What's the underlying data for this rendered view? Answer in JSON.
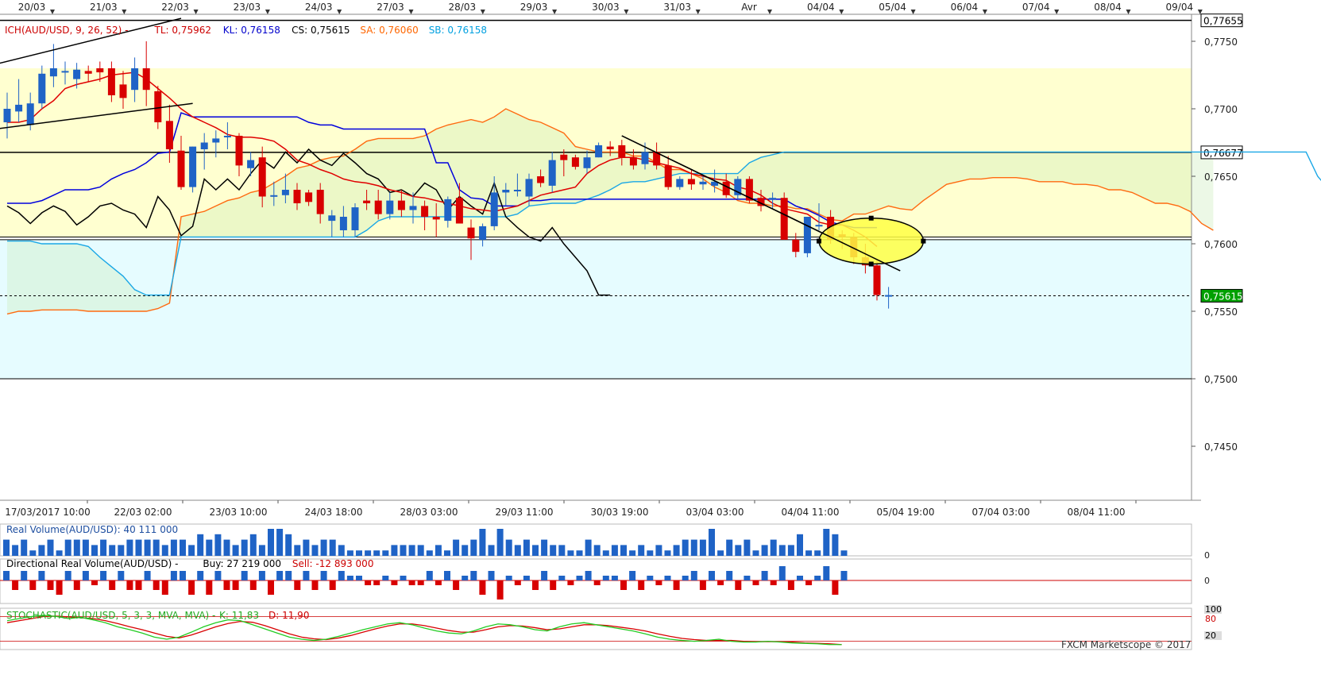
{
  "chart_data": {
    "type": "candlestick",
    "instrument": "AUD/USD",
    "watermark": "FXCM Marketscope © 2017",
    "top_dates": [
      "20/03",
      "21/03",
      "22/03",
      "23/03",
      "24/03",
      "27/03",
      "28/03",
      "29/03",
      "30/03",
      "31/03",
      "Avr",
      "04/04",
      "05/04",
      "06/04",
      "07/04",
      "08/04",
      "09/04"
    ],
    "bottom_times": [
      "17/03/2017 10:00",
      "22/03 02:00",
      "23/03 10:00",
      "24/03 18:00",
      "28/03 03:00",
      "29/03 11:00",
      "30/03 19:00",
      "03/04 03:00",
      "04/04 11:00",
      "05/04 19:00",
      "07/04 03:00",
      "08/04 11:00"
    ],
    "ylim": [
      0.741,
      0.777
    ],
    "y_ticks": [
      0.775,
      0.77,
      0.765,
      0.76,
      0.755,
      0.75,
      0.745
    ],
    "y_tick_labels": [
      "0,7750",
      "0,7700",
      "0,7650",
      "0,7600",
      "0,7550",
      "0,7500",
      "0,7450"
    ],
    "price_tags": [
      {
        "value": 0.77655,
        "label": "0,77655",
        "bg": "#ffffff",
        "fg": "#000000"
      },
      {
        "value": 0.76677,
        "label": "0,76677",
        "bg": "#ffffff",
        "fg": "#000000"
      },
      {
        "value": 0.75615,
        "label": "0,75615",
        "bg": "#00a000",
        "fg": "#ffffff"
      }
    ],
    "ichimoku_legend": [
      {
        "text": "ICH(AUD/USD, 9, 26, 52) -",
        "color": "#cc0000"
      },
      {
        "text": "TL: 0,75962",
        "color": "#cc0000"
      },
      {
        "text": "KL: 0,76158",
        "color": "#0000cc"
      },
      {
        "text": "CS: 0,75615",
        "color": "#000000"
      },
      {
        "text": "SA: 0,76060",
        "color": "#ff6600"
      },
      {
        "text": "SB: 0,76158",
        "color": "#00a0e0"
      }
    ],
    "zones": [
      {
        "from": 0.7605,
        "to": 0.773,
        "color": "#ffffd0"
      },
      {
        "from": 0.75,
        "to": 0.7603,
        "color": "#e6fcff"
      }
    ],
    "horizontal_lines": [
      0.77655,
      0.76677,
      0.7605,
      0.7603,
      0.75
    ],
    "candles": [
      [
        0.769,
        0.7712,
        0.7678,
        0.77
      ],
      [
        0.7698,
        0.7722,
        0.769,
        0.7703
      ],
      [
        0.7688,
        0.7712,
        0.7684,
        0.7704
      ],
      [
        0.7704,
        0.7732,
        0.77,
        0.7726
      ],
      [
        0.7724,
        0.7748,
        0.7716,
        0.773
      ],
      [
        0.7727,
        0.7735,
        0.7718,
        0.7728
      ],
      [
        0.7722,
        0.7734,
        0.7715,
        0.7729
      ],
      [
        0.7728,
        0.7732,
        0.772,
        0.7726
      ],
      [
        0.773,
        0.7735,
        0.772,
        0.7727
      ],
      [
        0.773,
        0.7735,
        0.7705,
        0.771
      ],
      [
        0.7718,
        0.7728,
        0.77,
        0.7708
      ],
      [
        0.7714,
        0.7738,
        0.7705,
        0.773
      ],
      [
        0.773,
        0.775,
        0.7702,
        0.7714
      ],
      [
        0.7713,
        0.7717,
        0.7685,
        0.769
      ],
      [
        0.7691,
        0.7703,
        0.766,
        0.767
      ],
      [
        0.7669,
        0.768,
        0.764,
        0.7642
      ],
      [
        0.7642,
        0.7672,
        0.7638,
        0.7672
      ],
      [
        0.767,
        0.7682,
        0.7655,
        0.7675
      ],
      [
        0.7675,
        0.7684,
        0.7664,
        0.7678
      ],
      [
        0.768,
        0.769,
        0.767,
        0.768
      ],
      [
        0.768,
        0.7682,
        0.765,
        0.7658
      ],
      [
        0.7656,
        0.7668,
        0.765,
        0.7662
      ],
      [
        0.7664,
        0.7672,
        0.7627,
        0.7635
      ],
      [
        0.7636,
        0.7646,
        0.7628,
        0.7636
      ],
      [
        0.7636,
        0.7652,
        0.763,
        0.764
      ],
      [
        0.764,
        0.7645,
        0.7625,
        0.763
      ],
      [
        0.7638,
        0.764,
        0.7628,
        0.7631
      ],
      [
        0.764,
        0.7645,
        0.7615,
        0.7622
      ],
      [
        0.7617,
        0.7625,
        0.7605,
        0.7621
      ],
      [
        0.761,
        0.7628,
        0.7605,
        0.762
      ],
      [
        0.761,
        0.763,
        0.7605,
        0.7627
      ],
      [
        0.7632,
        0.764,
        0.7625,
        0.763
      ],
      [
        0.7632,
        0.764,
        0.7618,
        0.7622
      ],
      [
        0.7622,
        0.7638,
        0.7618,
        0.7632
      ],
      [
        0.7632,
        0.764,
        0.762,
        0.7625
      ],
      [
        0.7625,
        0.7638,
        0.7615,
        0.7628
      ],
      [
        0.7628,
        0.7632,
        0.761,
        0.762
      ],
      [
        0.762,
        0.763,
        0.7605,
        0.7618
      ],
      [
        0.7617,
        0.7635,
        0.7612,
        0.7633
      ],
      [
        0.7634,
        0.7645,
        0.762,
        0.7615
      ],
      [
        0.7612,
        0.7618,
        0.7588,
        0.7604
      ],
      [
        0.7603,
        0.7615,
        0.7598,
        0.7613
      ],
      [
        0.7613,
        0.765,
        0.761,
        0.7638
      ],
      [
        0.7638,
        0.7645,
        0.7628,
        0.764
      ],
      [
        0.764,
        0.7652,
        0.7635,
        0.764
      ],
      [
        0.7635,
        0.7652,
        0.7628,
        0.7648
      ],
      [
        0.765,
        0.7655,
        0.7642,
        0.7645
      ],
      [
        0.7643,
        0.7668,
        0.7638,
        0.7662
      ],
      [
        0.7666,
        0.767,
        0.765,
        0.7662
      ],
      [
        0.7664,
        0.7666,
        0.7655,
        0.7657
      ],
      [
        0.7656,
        0.7669,
        0.7652,
        0.7664
      ],
      [
        0.7664,
        0.7675,
        0.7664,
        0.7673
      ],
      [
        0.7672,
        0.7676,
        0.7665,
        0.767
      ],
      [
        0.7673,
        0.7677,
        0.7658,
        0.7664
      ],
      [
        0.7664,
        0.767,
        0.7655,
        0.7658
      ],
      [
        0.7659,
        0.7675,
        0.7655,
        0.7668
      ],
      [
        0.7668,
        0.7675,
        0.7655,
        0.7658
      ],
      [
        0.7658,
        0.7665,
        0.764,
        0.7642
      ],
      [
        0.7642,
        0.765,
        0.764,
        0.7648
      ],
      [
        0.7648,
        0.7655,
        0.764,
        0.7644
      ],
      [
        0.7644,
        0.765,
        0.764,
        0.7646
      ],
      [
        0.7643,
        0.7655,
        0.7638,
        0.7646
      ],
      [
        0.7646,
        0.7652,
        0.7634,
        0.7636
      ],
      [
        0.7636,
        0.765,
        0.7633,
        0.7648
      ],
      [
        0.7648,
        0.765,
        0.763,
        0.7632
      ],
      [
        0.7634,
        0.764,
        0.7624,
        0.7628
      ],
      [
        0.7633,
        0.7638,
        0.7626,
        0.7634
      ],
      [
        0.7634,
        0.7638,
        0.7603,
        0.7603
      ],
      [
        0.7603,
        0.7608,
        0.759,
        0.7594
      ],
      [
        0.7593,
        0.762,
        0.759,
        0.762
      ],
      [
        0.7614,
        0.763,
        0.761,
        0.7614
      ],
      [
        0.762,
        0.7625,
        0.76,
        0.7603
      ],
      [
        0.7607,
        0.761,
        0.7596,
        0.7605
      ],
      [
        0.7605,
        0.7608,
        0.7585,
        0.759
      ],
      [
        0.759,
        0.76,
        0.7578,
        0.7584
      ],
      [
        0.7584,
        0.7588,
        0.7558,
        0.7562
      ],
      [
        0.7562,
        0.7568,
        0.7552,
        0.7562
      ]
    ],
    "tenkan": [
      0.769,
      0.769,
      0.7692,
      0.77,
      0.7706,
      0.7715,
      0.7718,
      0.772,
      0.7722,
      0.7725,
      0.7726,
      0.7727,
      0.7722,
      0.7715,
      0.7708,
      0.77,
      0.7694,
      0.769,
      0.7686,
      0.7681,
      0.7679,
      0.7679,
      0.7678,
      0.7676,
      0.767,
      0.7662,
      0.7659,
      0.7655,
      0.7652,
      0.7648,
      0.7646,
      0.7645,
      0.7643,
      0.764,
      0.7638,
      0.7635,
      0.7634,
      0.7632,
      0.763,
      0.7628,
      0.7626,
      0.7625,
      0.7624,
      0.7626,
      0.7628,
      0.7632,
      0.7636,
      0.7638,
      0.764,
      0.7642,
      0.7652,
      0.7658,
      0.7662,
      0.7664,
      0.7664,
      0.7662,
      0.766,
      0.7658,
      0.7656,
      0.7652,
      0.765,
      0.7648,
      0.7647,
      0.7642,
      0.764,
      0.7636,
      0.763,
      0.7626,
      0.7624,
      0.7622,
      0.7616,
      0.7614,
      0.7614,
      0.761,
      0.7605,
      0.7598
    ],
    "kijun": [
      0.763,
      0.763,
      0.763,
      0.7632,
      0.7636,
      0.764,
      0.764,
      0.764,
      0.7642,
      0.7648,
      0.7652,
      0.7655,
      0.766,
      0.7667,
      0.7668,
      0.7697,
      0.7694,
      0.7694,
      0.7694,
      0.7694,
      0.7694,
      0.7694,
      0.7694,
      0.7694,
      0.7694,
      0.7694,
      0.769,
      0.7688,
      0.7688,
      0.7685,
      0.7685,
      0.7685,
      0.7685,
      0.7685,
      0.7685,
      0.7685,
      0.7685,
      0.766,
      0.766,
      0.764,
      0.7634,
      0.7633,
      0.7628,
      0.7628,
      0.7628,
      0.7632,
      0.7632,
      0.7633,
      0.7633,
      0.7633,
      0.7633,
      0.7633,
      0.7633,
      0.7633,
      0.7633,
      0.7633,
      0.7633,
      0.7633,
      0.7633,
      0.7633,
      0.7633,
      0.7633,
      0.7633,
      0.7633,
      0.7633,
      0.7633,
      0.7633,
      0.7633,
      0.7628,
      0.7625,
      0.7621,
      0.7616,
      0.7614,
      0.7612,
      0.7612,
      0.7612
    ],
    "chikou": [
      0.7628,
      0.7623,
      0.7615,
      0.7623,
      0.7628,
      0.7624,
      0.7614,
      0.762,
      0.7628,
      0.763,
      0.7625,
      0.7622,
      0.7612,
      0.7635,
      0.7625,
      0.7606,
      0.7613,
      0.7648,
      0.764,
      0.7648,
      0.764,
      0.7652,
      0.7662,
      0.7656,
      0.7668,
      0.766,
      0.767,
      0.7662,
      0.7658,
      0.7667,
      0.766,
      0.7652,
      0.7648,
      0.7638,
      0.764,
      0.7635,
      0.7645,
      0.764,
      0.7625,
      0.7635,
      0.7628,
      0.7622,
      0.7645,
      0.762,
      0.7612,
      0.7605,
      0.7602,
      0.7612,
      0.76,
      0.759,
      0.758,
      0.7562,
      0.7562
    ],
    "senkou_a": [
      0.7548,
      0.755,
      0.755,
      0.7551,
      0.7551,
      0.7551,
      0.7551,
      0.755,
      0.755,
      0.755,
      0.755,
      0.755,
      0.755,
      0.7552,
      0.7556,
      0.762,
      0.7622,
      0.7624,
      0.7628,
      0.7632,
      0.7634,
      0.7638,
      0.764,
      0.7645,
      0.765,
      0.7656,
      0.7658,
      0.7662,
      0.7664,
      0.7665,
      0.767,
      0.7676,
      0.7678,
      0.7678,
      0.7678,
      0.7678,
      0.768,
      0.7685,
      0.7688,
      0.769,
      0.7692,
      0.769,
      0.7694,
      0.77,
      0.7696,
      0.7692,
      0.769,
      0.7686,
      0.7682,
      0.7672,
      0.767,
      0.7668,
      0.7668,
      0.7668,
      0.7665,
      0.7665,
      0.766,
      0.7655,
      0.7655,
      0.7652,
      0.7648,
      0.7642,
      0.7638,
      0.7632,
      0.763,
      0.763,
      0.7628,
      0.7628,
      0.7626,
      0.7626,
      0.7622,
      0.7618,
      0.7617,
      0.7622,
      0.7622,
      0.7625,
      0.7628,
      0.7626,
      0.7625,
      0.7632,
      0.7638,
      0.7644,
      0.7646,
      0.7648,
      0.7648,
      0.7649,
      0.7649,
      0.7649,
      0.7648,
      0.7646,
      0.7646,
      0.7646,
      0.7644,
      0.7644,
      0.7643,
      0.764,
      0.764,
      0.7638,
      0.7634,
      0.763,
      0.763,
      0.7628,
      0.7624,
      0.7615,
      0.761
    ],
    "senkou_b": [
      0.7602,
      0.7602,
      0.7602,
      0.76,
      0.76,
      0.76,
      0.76,
      0.7598,
      0.759,
      0.7583,
      0.7576,
      0.7566,
      0.7562,
      0.7562,
      0.7562,
      0.7605,
      0.7605,
      0.7605,
      0.7605,
      0.7605,
      0.7605,
      0.7605,
      0.7605,
      0.7605,
      0.7605,
      0.7605,
      0.7605,
      0.7605,
      0.7605,
      0.7605,
      0.7605,
      0.761,
      0.7617,
      0.762,
      0.762,
      0.762,
      0.762,
      0.762,
      0.762,
      0.762,
      0.762,
      0.762,
      0.762,
      0.762,
      0.7622,
      0.7628,
      0.7629,
      0.763,
      0.763,
      0.763,
      0.7633,
      0.7636,
      0.764,
      0.7645,
      0.7646,
      0.7646,
      0.7648,
      0.765,
      0.7652,
      0.7652,
      0.7652,
      0.7652,
      0.7652,
      0.7652,
      0.766,
      0.7664,
      0.7666,
      0.7668,
      0.7668,
      0.7668,
      0.7668,
      0.7668,
      0.7668,
      0.7668,
      0.7668,
      0.7668,
      0.7668,
      0.7668,
      0.7668,
      0.7668,
      0.7668,
      0.7668,
      0.7668,
      0.7668,
      0.7668,
      0.7668,
      0.7668,
      0.7668,
      0.7668,
      0.7668,
      0.7668,
      0.7668,
      0.7668,
      0.7668,
      0.7668,
      0.7668,
      0.7668,
      0.7668,
      0.7668,
      0.7668,
      0.7668,
      0.7668,
      0.7668,
      0.7668,
      0.7668,
      0.7668,
      0.7668,
      0.7668,
      0.7668,
      0.7668,
      0.7668,
      0.7668,
      0.7668,
      0.765,
      0.764,
      0.7628,
      0.7626,
      0.7624,
      0.762,
      0.7614
    ],
    "trendlines": [
      {
        "from": [
          -1,
          0.7733
        ],
        "to": [
          15,
          0.7767
        ]
      },
      {
        "from": [
          -1,
          0.7685
        ],
        "to": [
          16,
          0.7704
        ]
      },
      {
        "from": [
          53,
          0.768
        ],
        "to": [
          77,
          0.758
        ]
      }
    ],
    "highlight_ellipse": {
      "center": [
        74.5,
        0.7602
      ],
      "radius_x": 4.5,
      "radius_y": 0.0017
    },
    "volume": {
      "title": "Real Volume(AUD/USD): 40 111 000",
      "y_tick_labels": [
        "0"
      ],
      "values": [
        3,
        2,
        3,
        1,
        2,
        3,
        1,
        3,
        3,
        3,
        2,
        3,
        2,
        2,
        3,
        3,
        3,
        3,
        2,
        3,
        3,
        2,
        4,
        3,
        4,
        3,
        2,
        3,
        4,
        2,
        5,
        5,
        4,
        2,
        3,
        2,
        3,
        3,
        2,
        1,
        1,
        1,
        1,
        1,
        2,
        2,
        2,
        2,
        1,
        2,
        1,
        3,
        2,
        3,
        5,
        2,
        5,
        3,
        2,
        3,
        2,
        3,
        2,
        2,
        1,
        1,
        3,
        2,
        1,
        2,
        2,
        1,
        2,
        1,
        2,
        1,
        2,
        3,
        3,
        3,
        5,
        1,
        3,
        2,
        3,
        1,
        2,
        3,
        2,
        2,
        4,
        1,
        1,
        5,
        4,
        1
      ]
    },
    "directional": {
      "title_parts": [
        {
          "text": "Directional Real Volume(AUD/USD) -",
          "color": "#000000"
        },
        {
          "text": "Buy: 27 219 000",
          "color": "#000000"
        },
        {
          "text": "Sell: -12 893 000",
          "color": "#cc0000"
        }
      ],
      "y_tick_labels": [
        "0"
      ],
      "values": [
        2,
        -2,
        2,
        -2,
        2,
        -2,
        -3,
        2,
        -2,
        2,
        -1,
        2,
        -2,
        2,
        -2,
        -2,
        2,
        -2,
        -3,
        2,
        2,
        -3,
        2,
        -3,
        2,
        -2,
        -2,
        2,
        -2,
        2,
        -3,
        2,
        2,
        -2,
        2,
        -2,
        2,
        -2,
        2,
        1,
        1,
        -1,
        -1,
        1,
        -1,
        1,
        -1,
        -1,
        2,
        -1,
        2,
        -2,
        1,
        2,
        -3,
        2,
        -4,
        1,
        -1,
        1,
        -2,
        2,
        -2,
        1,
        -1,
        1,
        2,
        -1,
        1,
        1,
        -2,
        2,
        -2,
        1,
        -1,
        1,
        -2,
        1,
        2,
        -2,
        2,
        -1,
        2,
        -2,
        1,
        -1,
        2,
        -1,
        3,
        -2,
        1,
        -1,
        1,
        3,
        -3,
        2
      ]
    },
    "stochastic": {
      "title": "STOCHASTIC(AUD/USD, 5, 3, 3, MVA, MVA) -",
      "k_label": "K: 11,83",
      "d_label": "D: 11,90",
      "ylim": [
        0,
        100
      ],
      "levels": [
        80,
        20
      ],
      "level_tags": [
        "100",
        "80",
        "20"
      ],
      "k": [
        70,
        75,
        80,
        83,
        80,
        75,
        78,
        72,
        65,
        55,
        48,
        40,
        30,
        25,
        30,
        42,
        55,
        65,
        72,
        70,
        60,
        50,
        40,
        30,
        25,
        22,
        25,
        32,
        40,
        48,
        55,
        62,
        65,
        60,
        52,
        45,
        40,
        38,
        45,
        55,
        62,
        60,
        55,
        48,
        45,
        55,
        62,
        65,
        60,
        55,
        50,
        45,
        38,
        30,
        25,
        22,
        20,
        22,
        25,
        20,
        18,
        18,
        20,
        18,
        16,
        15,
        14,
        12,
        12
      ],
      "d": [
        65,
        70,
        75,
        80,
        81,
        79,
        77,
        75,
        70,
        63,
        55,
        48,
        40,
        32,
        28,
        35,
        45,
        55,
        63,
        68,
        66,
        58,
        48,
        38,
        30,
        26,
        24,
        28,
        34,
        42,
        50,
        57,
        62,
        62,
        58,
        52,
        46,
        42,
        42,
        48,
        55,
        58,
        57,
        53,
        48,
        50,
        55,
        60,
        60,
        58,
        54,
        50,
        45,
        38,
        32,
        27,
        24,
        22,
        22,
        22,
        20,
        19,
        19,
        19,
        18,
        16,
        15,
        14,
        12
      ]
    }
  }
}
